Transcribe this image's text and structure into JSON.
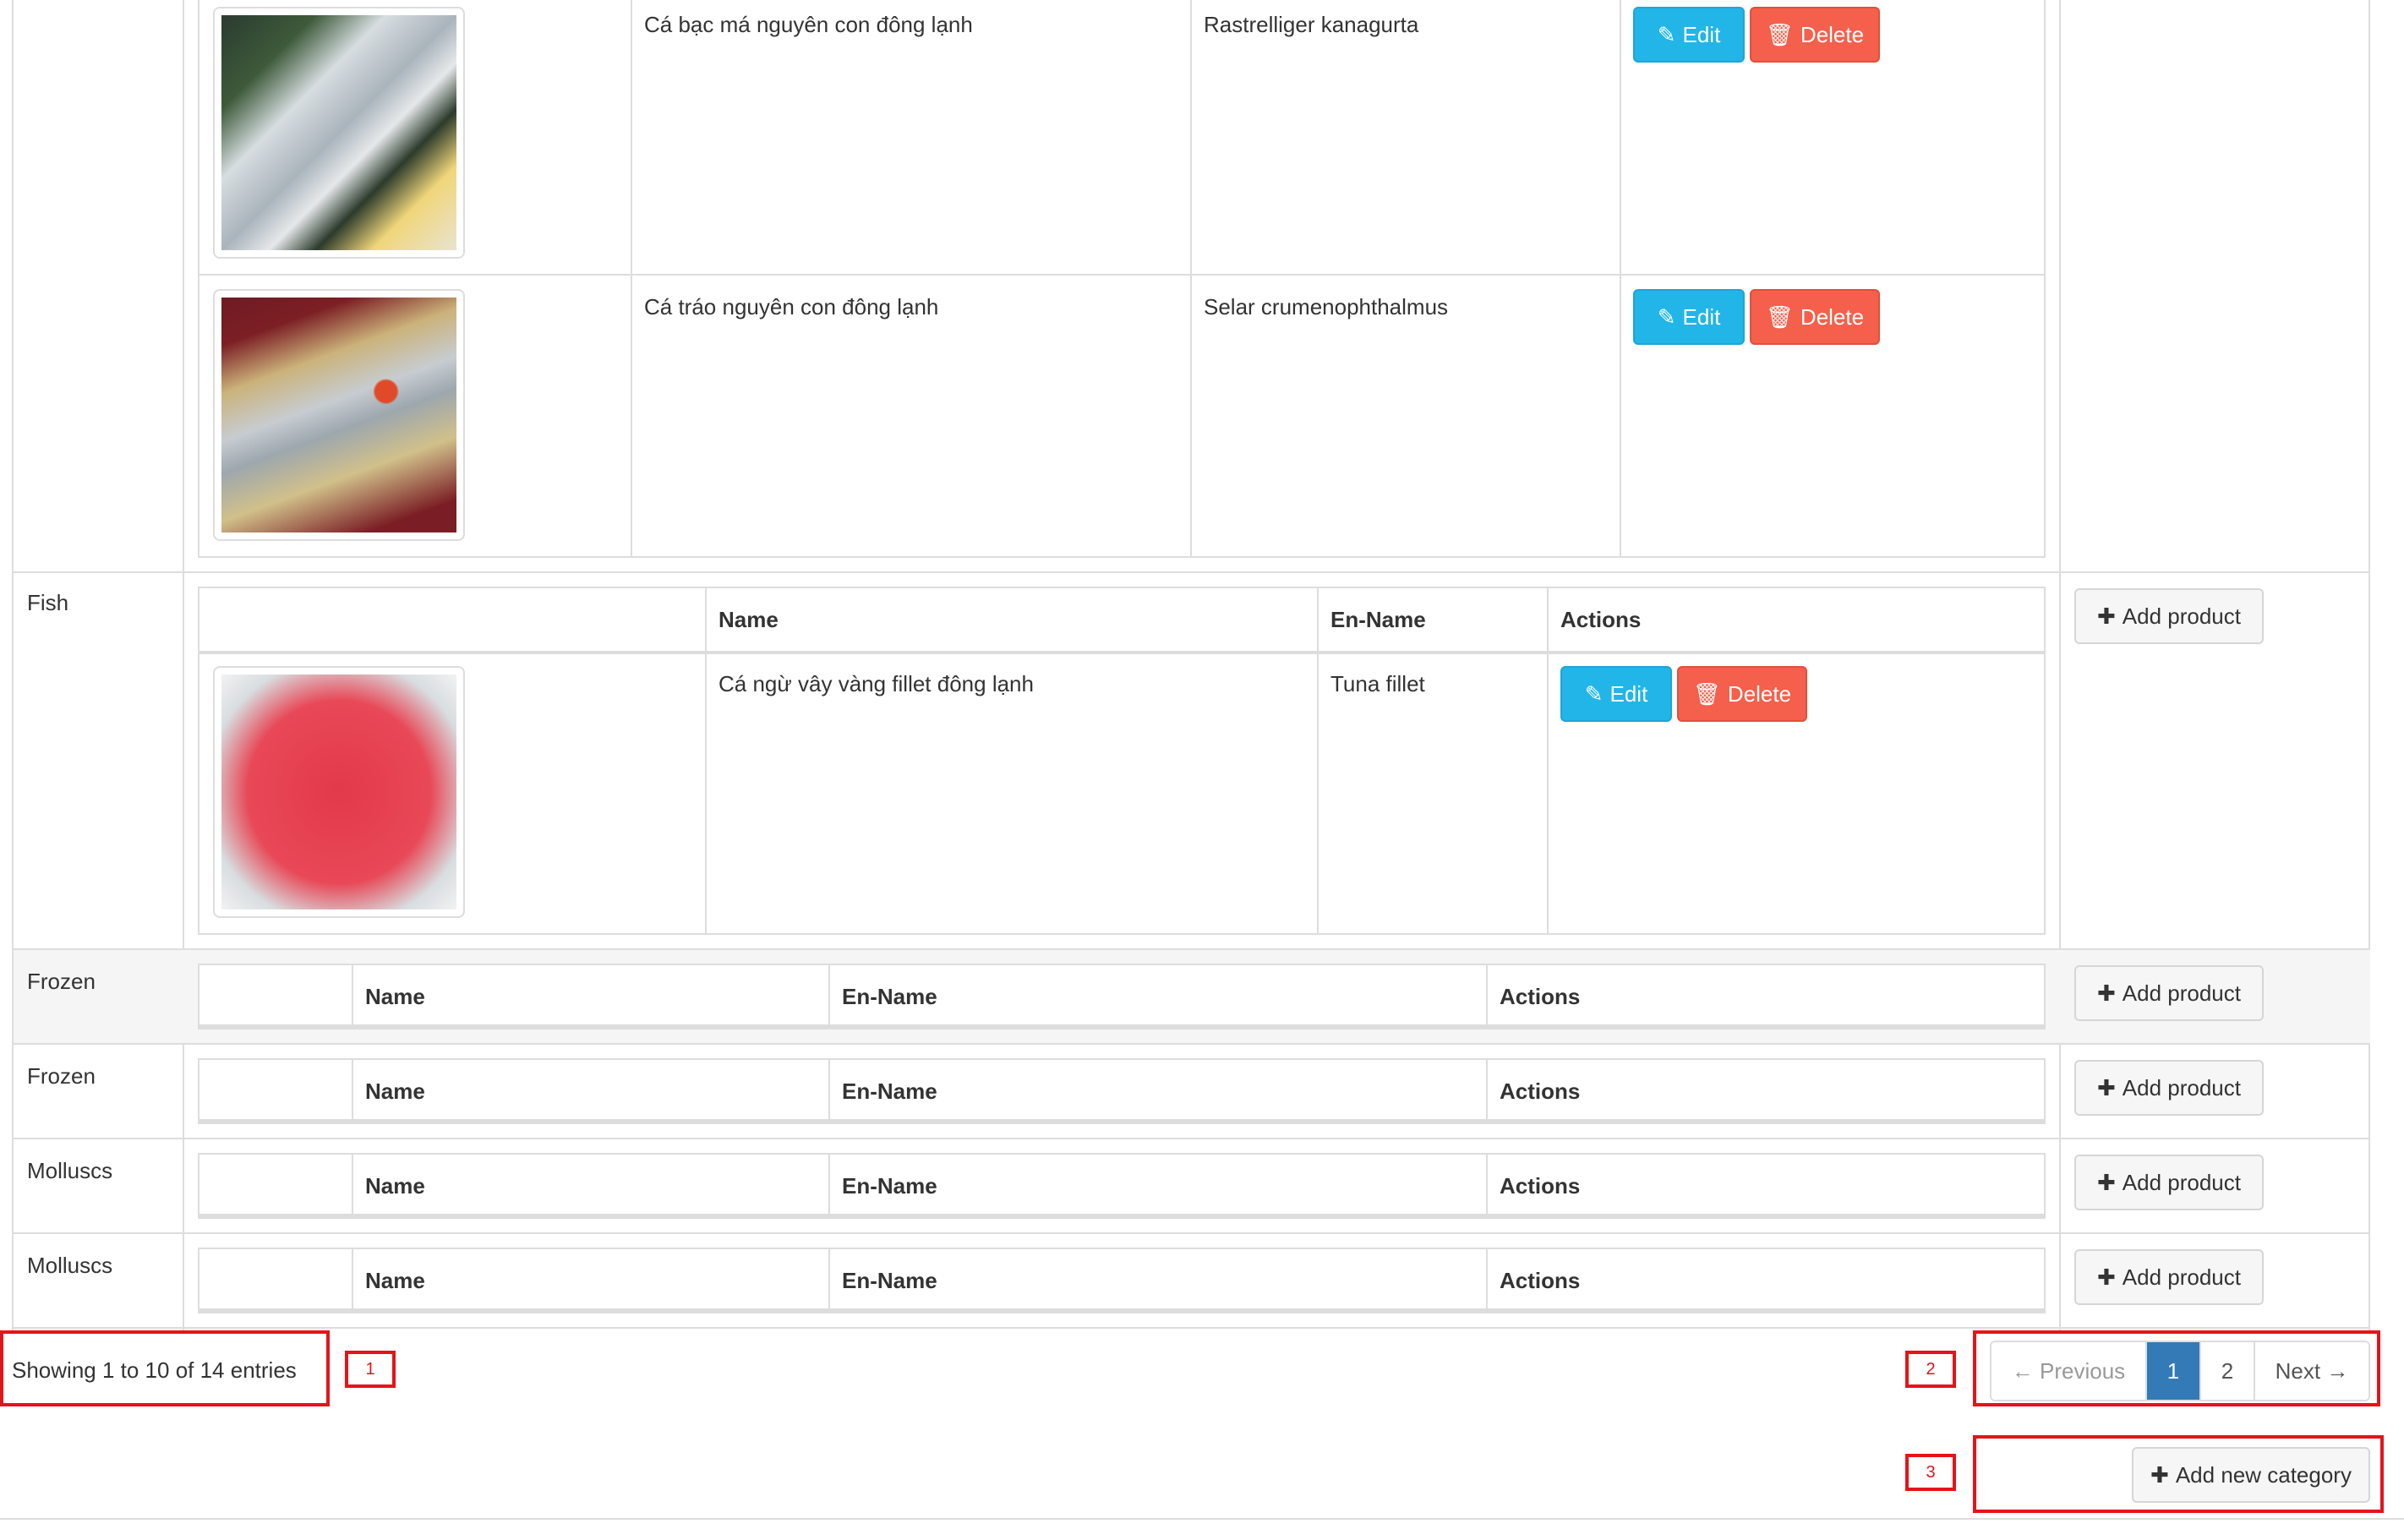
{
  "headers": {
    "name": "Name",
    "en_name": "En-Name",
    "actions": "Actions"
  },
  "buttons": {
    "edit": "Edit",
    "delete": "Delete",
    "add_product": "Add product",
    "add_new_category": "Add new category"
  },
  "products_top": [
    {
      "name": "Cá bạc má nguyên con đông lạnh",
      "en_name": "Rastrelliger kanagurta"
    },
    {
      "name": "Cá tráo nguyên con đông lạnh",
      "en_name": "Selar crumenophthalmus"
    }
  ],
  "categories": [
    {
      "label": "Fish",
      "products": [
        {
          "name": "Cá ngừ vây vàng fillet đông lạnh",
          "en_name": "Tuna fillet"
        }
      ]
    },
    {
      "label": "Frozen"
    },
    {
      "label": "Frozen"
    },
    {
      "label": "Molluscs"
    },
    {
      "label": "Molluscs"
    }
  ],
  "footer": {
    "showing": "Showing 1 to 10 of 14 entries"
  },
  "pagination": {
    "previous": "← Previous",
    "page1": "1",
    "page2": "2",
    "next": "Next →"
  },
  "annotations": [
    "1",
    "2",
    "3"
  ],
  "icons": {
    "edit": "edit-icon",
    "delete": "trash-icon",
    "plus": "plus-icon"
  },
  "colors": {
    "edit": "#22b5e8",
    "delete": "#f4604c",
    "active_page": "#337ab7",
    "annotation": "#e4141a",
    "stripe": "#f5f5f5"
  }
}
